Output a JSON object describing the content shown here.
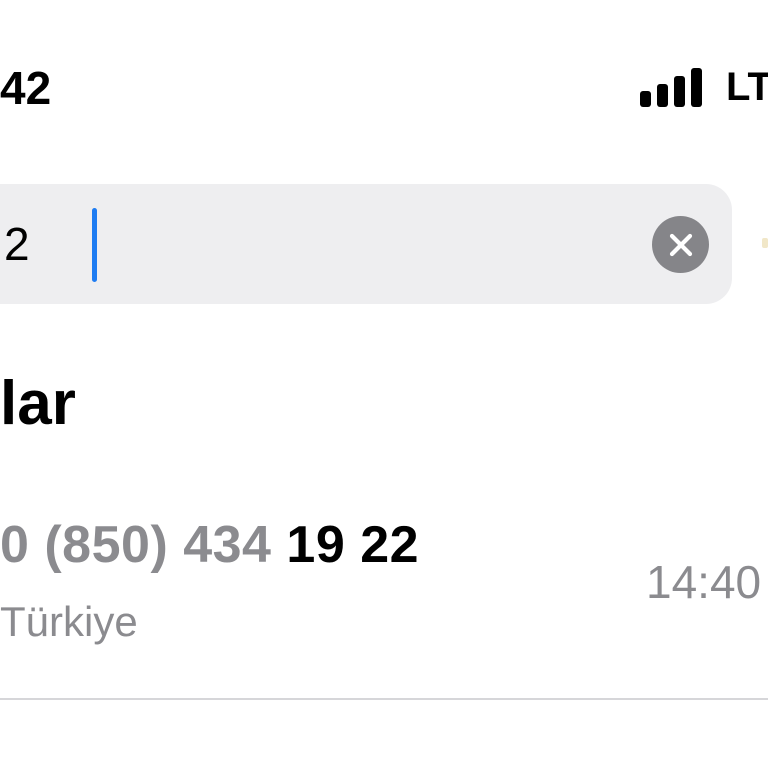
{
  "status_bar": {
    "time": "42",
    "network": "LT",
    "signal_icon": "cellular-signal-icon"
  },
  "search": {
    "value": "2",
    "clear_icon": "clear-x-icon",
    "caret_color": "#1e7cf2"
  },
  "section": {
    "title": "lar"
  },
  "result": {
    "number_prefix": "0 (850) 434 ",
    "number_match": "19 22",
    "country": "Türkiye",
    "time": "14:40"
  },
  "colors": {
    "search_bg": "#eeeef0",
    "secondary_text": "#8b8b8f",
    "clear_button": "#858589"
  }
}
